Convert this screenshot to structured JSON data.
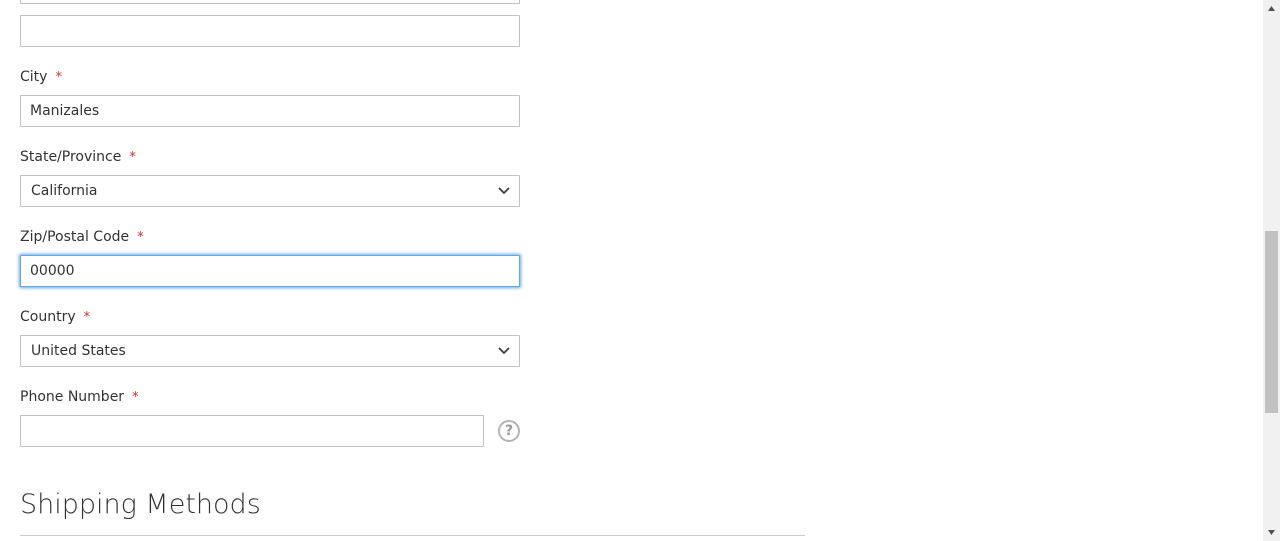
{
  "form": {
    "street_line_2": {
      "value": ""
    },
    "street_line_3": {
      "value": ""
    },
    "city": {
      "label": "City",
      "required_mark": "*",
      "value": "Manizales"
    },
    "state": {
      "label": "State/Province",
      "required_mark": "*",
      "selected": "California"
    },
    "zip": {
      "label": "Zip/Postal Code",
      "required_mark": "*",
      "value": "00000"
    },
    "country": {
      "label": "Country",
      "required_mark": "*",
      "selected": "United States"
    },
    "phone": {
      "label": "Phone Number",
      "required_mark": "*",
      "value": "",
      "help_glyph": "?"
    }
  },
  "shipping": {
    "title": "Shipping Methods"
  },
  "icons": {
    "state_chevron": "chevron-down-icon",
    "country_chevron": "chevron-down-icon",
    "phone_help": "question-circle-icon",
    "scroll_up": "arrow-up-icon",
    "scroll_down": "arrow-down-icon"
  },
  "colors": {
    "required": "#e02b27",
    "focus_border": "#68a8e0",
    "input_border": "#c2c2c2",
    "text": "#333333"
  }
}
